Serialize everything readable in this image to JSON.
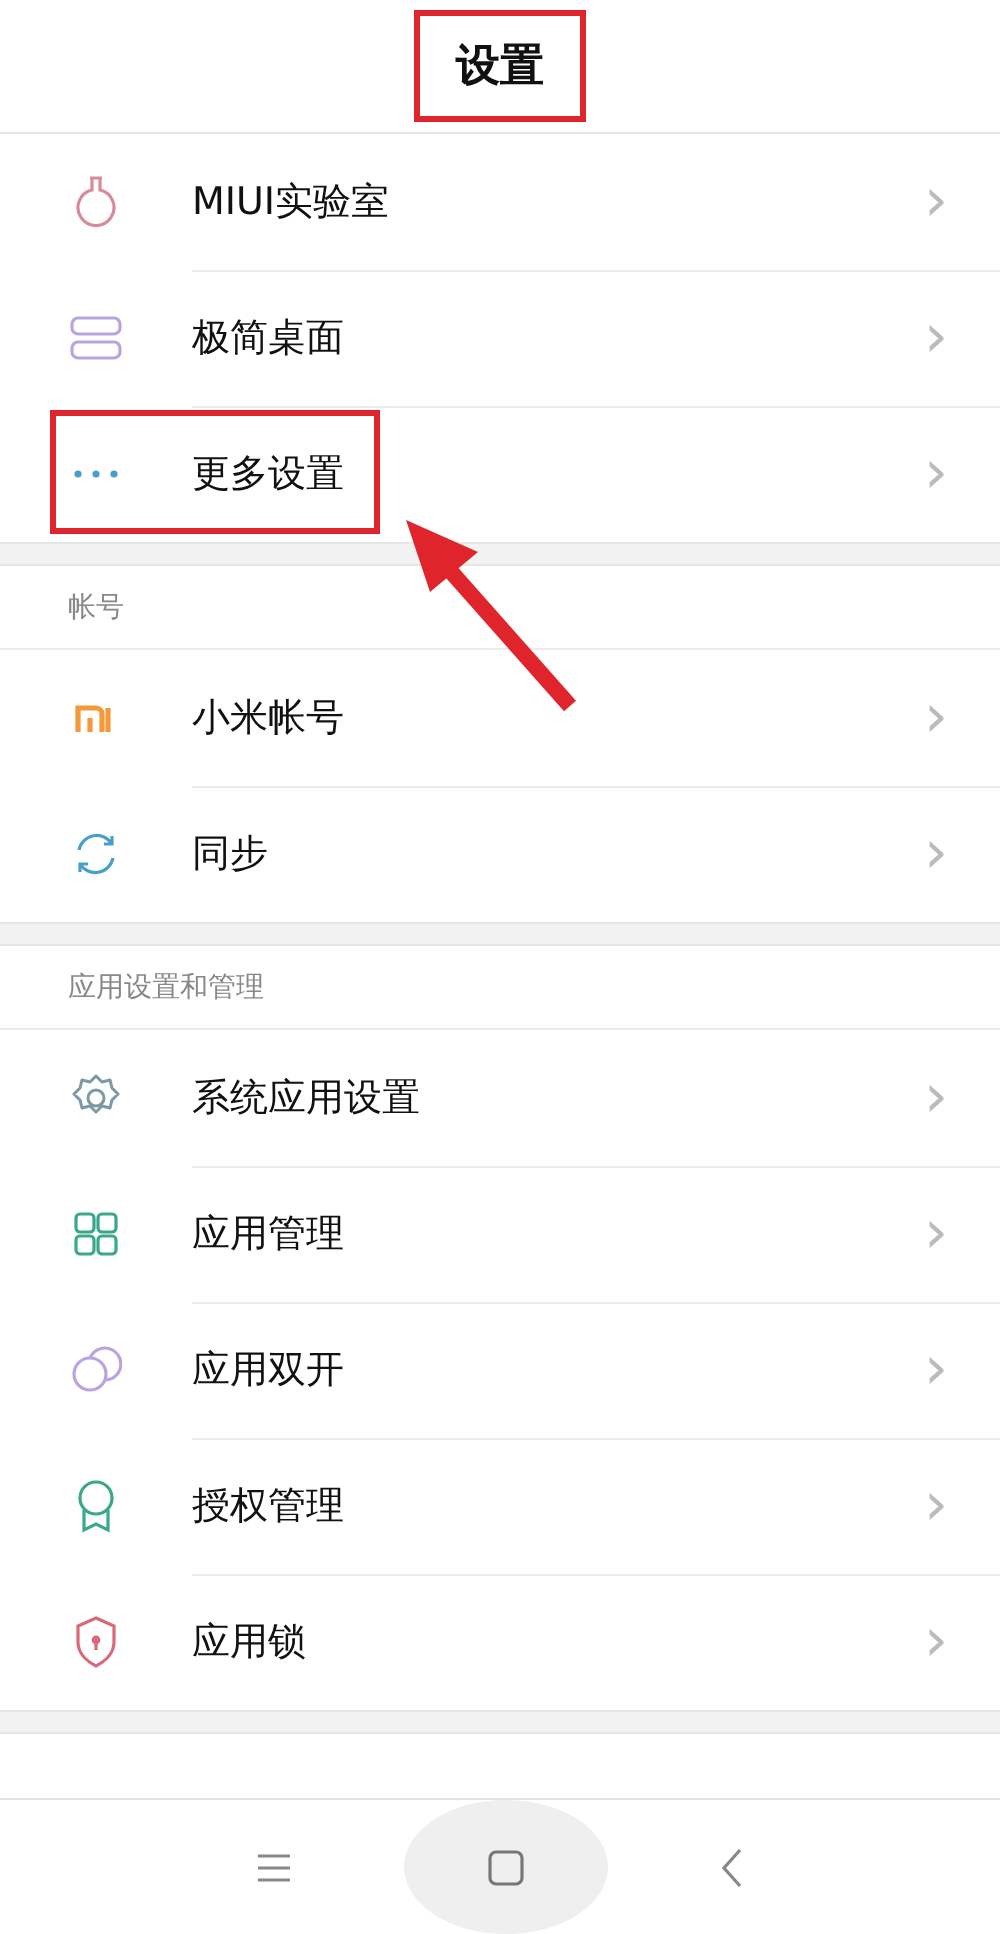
{
  "header": {
    "title": "设置",
    "highlighted": true
  },
  "sections": [
    {
      "items": [
        {
          "label": "MIUI实验室",
          "chevron": "›",
          "highlighted": false
        },
        {
          "label": "极简桌面",
          "chevron": "›",
          "highlighted": false
        },
        {
          "label": "更多设置",
          "chevron": "›",
          "highlighted": true
        }
      ]
    },
    {
      "heading": "帐号",
      "items": [
        {
          "label": "小米帐号",
          "chevron": "›",
          "highlighted": false
        },
        {
          "label": "同步",
          "chevron": "›",
          "highlighted": false
        }
      ]
    },
    {
      "heading": "应用设置和管理",
      "items": [
        {
          "label": "系统应用设置",
          "chevron": "›",
          "highlighted": false
        },
        {
          "label": "应用管理",
          "chevron": "›",
          "highlighted": false
        },
        {
          "label": "应用双开",
          "chevron": "›",
          "highlighted": false
        },
        {
          "label": "授权管理",
          "chevron": "›",
          "highlighted": false
        },
        {
          "label": "应用锁",
          "chevron": "›",
          "highlighted": false
        }
      ]
    }
  ]
}
